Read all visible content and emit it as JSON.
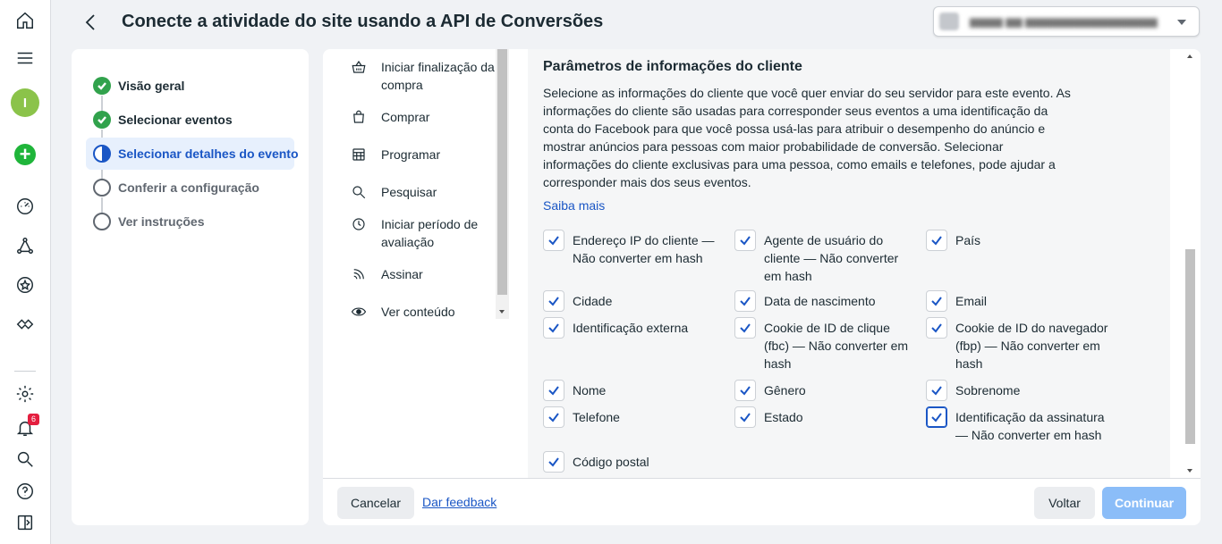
{
  "header": {
    "title": "Conecte a atividade do site usando a API de Conversões"
  },
  "rail": {
    "avatar_letter": "I",
    "notification_count": "6"
  },
  "steps": [
    {
      "label": "Visão geral",
      "state": "done"
    },
    {
      "label": "Selecionar eventos",
      "state": "done"
    },
    {
      "label": "Selecionar detalhes do evento",
      "state": "active"
    },
    {
      "label": "Conferir a configuração",
      "state": "todo"
    },
    {
      "label": "Ver instruções",
      "state": "todo"
    }
  ],
  "events": [
    {
      "label": "Iniciar finalização da compra",
      "icon": "basket-icon"
    },
    {
      "label": "Comprar",
      "icon": "shopping-bag-icon"
    },
    {
      "label": "Programar",
      "icon": "calendar-icon"
    },
    {
      "label": "Pesquisar",
      "icon": "search-icon"
    },
    {
      "label": "Iniciar período de avaliação",
      "icon": "clock-icon"
    },
    {
      "label": "Assinar",
      "icon": "rss-icon"
    },
    {
      "label": "Ver conteúdo",
      "icon": "eye-icon"
    }
  ],
  "params": {
    "title": "Parâmetros de informações do cliente",
    "description": "Selecione as informações do cliente que você quer enviar do seu servidor para este evento. As informações do cliente são usadas para corresponder seus eventos a uma identificação da conta do Facebook para que você possa usá-las para atribuir o desempenho do anúncio e mostrar anúncios para pessoas com maior probabilidade de conversão. Selecionar informações do cliente exclusivas para uma pessoa, como emails e telefones, pode ajudar a corresponder mais dos seus eventos.",
    "learn_more": "Saiba mais",
    "checkboxes": [
      {
        "label": "Endereço IP do cliente — Não converter em hash",
        "checked": true
      },
      {
        "label": "Agente de usuário do cliente — Não converter em hash",
        "checked": true
      },
      {
        "label": "País",
        "checked": true
      },
      {
        "label": "Cidade",
        "checked": true
      },
      {
        "label": "Data de nascimento",
        "checked": true
      },
      {
        "label": "Email",
        "checked": true
      },
      {
        "label": "Identificação externa",
        "checked": true
      },
      {
        "label": "Cookie de ID de clique (fbc) — Não converter em hash",
        "checked": true
      },
      {
        "label": "Cookie de ID do navegador (fbp) — Não converter em hash",
        "checked": true
      },
      {
        "label": "Nome",
        "checked": true
      },
      {
        "label": "Gênero",
        "checked": true
      },
      {
        "label": "Sobrenome",
        "checked": true
      },
      {
        "label": "Telefone",
        "checked": true
      },
      {
        "label": "Estado",
        "checked": true
      },
      {
        "label": "Identificação da assinatura — Não converter em hash",
        "checked": true
      },
      {
        "label": "Código postal",
        "checked": true
      }
    ]
  },
  "footer": {
    "cancel": "Cancelar",
    "feedback": "Dar feedback",
    "back": "Voltar",
    "continue": "Continuar"
  }
}
